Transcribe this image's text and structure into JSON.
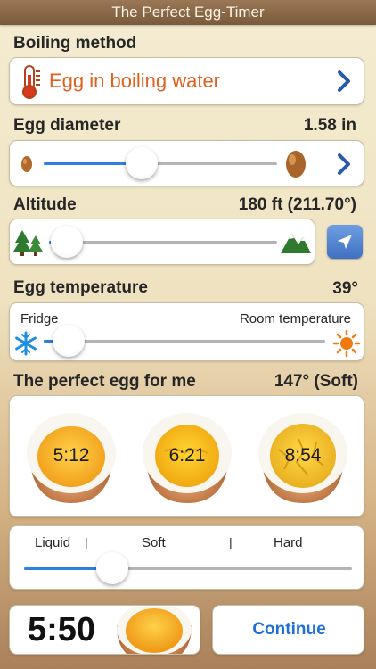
{
  "app": {
    "title": "The Perfect Egg-Timer"
  },
  "boiling_method": {
    "label": "Boiling method",
    "value": "Egg in boiling water",
    "icon": "thermometer-icon",
    "accent_color": "#e0611d"
  },
  "egg_diameter": {
    "label": "Egg diameter",
    "value": "1.58 in",
    "slider_fraction": 0.42
  },
  "altitude": {
    "label": "Altitude",
    "value": "180 ft (211.70°)",
    "slider_fraction": 0.08
  },
  "egg_temperature": {
    "label": "Egg temperature",
    "value": "39°",
    "left_label": "Fridge",
    "right_label": "Room temperature",
    "slider_fraction": 0.09
  },
  "perfect_egg": {
    "label": "The perfect egg for me",
    "value": "147° (Soft)",
    "eggs": [
      {
        "time": "5:12",
        "yolk": "liquid"
      },
      {
        "time": "6:21",
        "yolk": "soft"
      },
      {
        "time": "8:54",
        "yolk": "hard"
      }
    ]
  },
  "consistency": {
    "labels": [
      "Liquid",
      "Soft",
      "Hard"
    ],
    "slider_fraction": 0.27
  },
  "footer": {
    "timer": "5:50",
    "continue_label": "Continue"
  },
  "colors": {
    "accent_blue": "#2d7fe0",
    "continue_blue": "#1f6fd6"
  }
}
